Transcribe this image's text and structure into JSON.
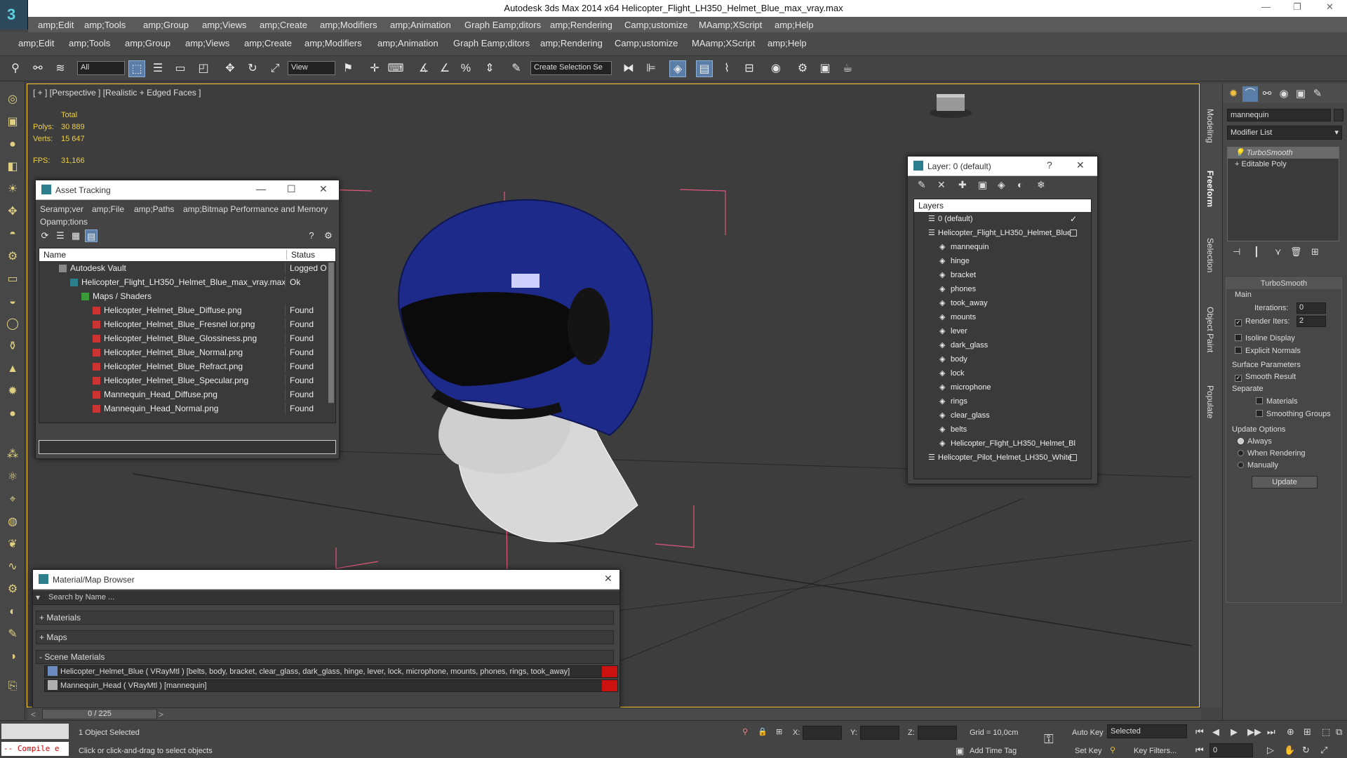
{
  "window": {
    "title": "Autodesk 3ds Max  2014 x64     Helicopter_Flight_LH350_Helmet_Blue_max_vray.max"
  },
  "menu1": [
    "amp;Edit",
    "amp;Tools",
    "amp;Group",
    "amp;Views",
    "amp;Create",
    "amp;Modifiers",
    "amp;Animation",
    "Graph Eamp;ditors",
    "amp;Rendering",
    "Camp;ustomize",
    "MAamp;XScript",
    "amp;Help"
  ],
  "menu2": [
    "amp;Edit",
    "amp;Tools",
    "amp;Group",
    "amp;Views",
    "amp;Create",
    "amp;Modifiers",
    "amp;Animation",
    "Graph Eamp;ditors",
    "amp;Rendering",
    "Camp;ustomize",
    "MAamp;XScript",
    "amp;Help"
  ],
  "toolbar": {
    "filter": "All",
    "ref_coord": "View",
    "selection_set": "Create Selection Se"
  },
  "viewport": {
    "label": "[ + ] [Perspective ] [Realistic + Edged Faces ]",
    "stats": {
      "header": "Total",
      "polys_label": "Polys:",
      "polys": "30 889",
      "verts_label": "Verts:",
      "verts": "15 647",
      "fps_label": "FPS:",
      "fps": "31,166"
    }
  },
  "viewport_tabs": [
    "Modeling",
    "Freeform",
    "Selection",
    "Object Paint",
    "Populate"
  ],
  "command_panel": {
    "object_name": "mannequin",
    "modifier_list": "Modifier List",
    "stack": [
      "TurboSmooth",
      "Editable Poly"
    ],
    "rollout_title": "TurboSmooth",
    "main": "Main",
    "iterations_label": "Iterations:",
    "iterations": "0",
    "render_iters_label": "Render Iters:",
    "render_iters": "2",
    "isoline": "Isoline Display",
    "explicit": "Explicit Normals",
    "surface": "Surface Parameters",
    "smooth": "Smooth Result",
    "separate": "Separate",
    "materials": "Materials",
    "smoothing_groups": "Smoothing Groups",
    "update_options": "Update Options",
    "always": "Always",
    "when_rendering": "When Rendering",
    "manually": "Manually",
    "update_btn": "Update"
  },
  "asset_tracking": {
    "title": "Asset Tracking",
    "menu": [
      "Seramp;ver",
      "amp;File",
      "amp;Paths",
      "amp;Bitmap Performance and Memory"
    ],
    "menu2": "Opamp;tions",
    "col_name": "Name",
    "col_status": "Status",
    "rows": [
      {
        "name": "Autodesk Vault",
        "status": "Logged O"
      },
      {
        "name": "Helicopter_Flight_LH350_Helmet_Blue_max_vray.max",
        "status": "Ok"
      },
      {
        "name": "Maps / Shaders",
        "status": ""
      },
      {
        "name": "Helicopter_Helmet_Blue_Diffuse.png",
        "status": "Found"
      },
      {
        "name": "Helicopter_Helmet_Blue_Fresnel ior.png",
        "status": "Found"
      },
      {
        "name": "Helicopter_Helmet_Blue_Glossiness.png",
        "status": "Found"
      },
      {
        "name": "Helicopter_Helmet_Blue_Normal.png",
        "status": "Found"
      },
      {
        "name": "Helicopter_Helmet_Blue_Refract.png",
        "status": "Found"
      },
      {
        "name": "Helicopter_Helmet_Blue_Specular.png",
        "status": "Found"
      },
      {
        "name": "Mannequin_Head_Diffuse.png",
        "status": "Found"
      },
      {
        "name": "Mannequin_Head_Normal.png",
        "status": "Found"
      }
    ]
  },
  "layer": {
    "title": "Layer: 0 (default)",
    "header": "Layers",
    "rows": [
      "0 (default)",
      "Helicopter_Flight_LH350_Helmet_Blue",
      "mannequin",
      "hinge",
      "bracket",
      "phones",
      "took_away",
      "mounts",
      "lever",
      "dark_glass",
      "body",
      "lock",
      "microphone",
      "rings",
      "clear_glass",
      "belts",
      "Helicopter_Flight_LH350_Helmet_Bl",
      "Helicopter_Pilot_Helmet_LH350_White"
    ]
  },
  "mat_browser": {
    "title": "Material/Map Browser",
    "search": "Search by Name ...",
    "materials": "+ Materials",
    "maps": "+ Maps",
    "scene": "- Scene Materials",
    "items": [
      "Helicopter_Helmet_Blue ( VRayMtl ) [belts, body, bracket, clear_glass, dark_glass, hinge, lever, lock, microphone, mounts, phones, rings, took_away]",
      "Mannequin_Head ( VRayMtl ) [mannequin]"
    ]
  },
  "status": {
    "timeline": "0 / 225",
    "compile": "-- Compile e",
    "selected": "1 Object Selected",
    "prompt": "Click or click-and-drag to select objects",
    "x": "X:",
    "y": "Y:",
    "z": "Z:",
    "grid": "Grid = 10,0cm",
    "autokey": "Auto Key",
    "setkey": "Set Key",
    "key_mode": "Selected",
    "key_filters": "Key Filters...",
    "add_time_tag": "Add Time Tag",
    "frame": "0"
  },
  "colors": {
    "accent": "#5b7ea8",
    "helmet": "#1e2a8a",
    "gizmo": "#e0587a",
    "stats": "#f0d040",
    "found_red": "#cc1111"
  }
}
